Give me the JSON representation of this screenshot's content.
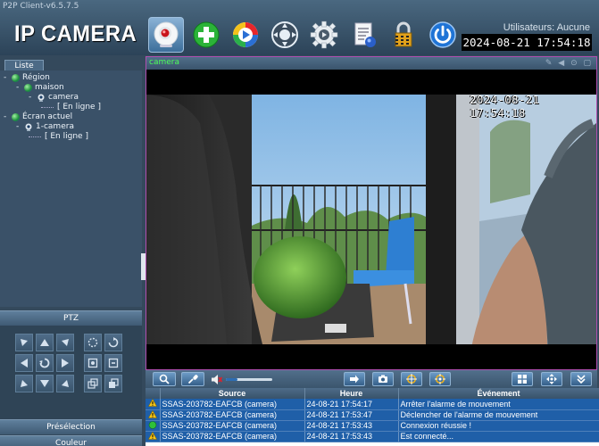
{
  "window": {
    "title": "P2P Client-v6.5.7.5",
    "logo": "IP CAMERA"
  },
  "toolbar": {
    "buttons": [
      {
        "name": "camera-icon"
      },
      {
        "name": "add-icon"
      },
      {
        "name": "playback-icon"
      },
      {
        "name": "ptz-control-icon"
      },
      {
        "name": "settings-icon"
      },
      {
        "name": "log-icon"
      },
      {
        "name": "lock-icon"
      },
      {
        "name": "power-icon"
      }
    ],
    "users_label": "Utilisateurs: Aucune",
    "clock": "2024-08-21  17:54:18"
  },
  "sidebar": {
    "tab_label": "Liste",
    "tree": {
      "region_label": "Région",
      "group_label": "maison",
      "device_label": "camera",
      "device_status": "[   En ligne   ]",
      "current_label": "Écran actuel",
      "current_device": "1-camera",
      "current_status": "[   En ligne   ]"
    },
    "ptz_label": "PTZ",
    "preset_label": "Présélection",
    "color_label": "Couleur"
  },
  "video": {
    "title": "camera",
    "osd_time": "2024-08-21  17:54:18"
  },
  "controls": {
    "volume_level": 0.25
  },
  "events": {
    "columns": [
      "Source",
      "Heure",
      "Événement"
    ],
    "rows": [
      {
        "icon": "warning-icon",
        "source": "SSAS-203782-EAFCB (camera)",
        "time": "24-08-21 17:54:17",
        "event": "Arrêter l'alarme de mouvement"
      },
      {
        "icon": "warning-icon",
        "source": "SSAS-203782-EAFCB (camera)",
        "time": "24-08-21 17:53:47",
        "event": "Déclencher de l'alarme de mouvement"
      },
      {
        "icon": "success-icon",
        "source": "SSAS-203782-EAFCB (camera)",
        "time": "24-08-21 17:53:43",
        "event": "Connexion réussie !"
      },
      {
        "icon": "warning-icon",
        "source": "SSAS-203782-EAFCB (camera)",
        "time": "24-08-21 17:53:43",
        "event": "Est connecté..."
      }
    ]
  },
  "colors": {
    "accent": "#2d6db3",
    "video_border": "#b04fb0",
    "online_text": "#4cff5a"
  }
}
